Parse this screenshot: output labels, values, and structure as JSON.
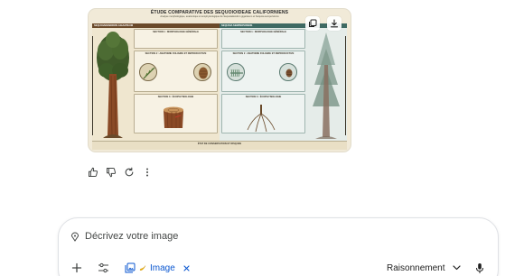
{
  "poster": {
    "title": "ÉTUDE COMPARATIVE DES SEQUOIOIDEAE CALIFORNIENS",
    "subtitle": "Analyse morphologique, anatomique et écophysiologique de Sequoiadendron giganteum et Sequoia sempervirens",
    "left": {
      "header": "SEQUOIADENDRON GIGANTEUM",
      "section1": "SECTION 1 : MORPHOLOGIE GÉNÉRALE",
      "section2": "SECTION 2 : ANATOMIE FOLIAIRE ET REPRODUCTIVE",
      "section3": "SECTION 3 : ÉCOPHYSIOLOGIE"
    },
    "right": {
      "header": "SEQUOIA SEMPERVIRENS",
      "section1": "SECTION 1 : MORPHOLOGIE GÉNÉRALE",
      "section2": "SECTION 2 : ANATOMIE FOLIAIRE ET REPRODUCTIVE",
      "section3": "SECTION 3 : ÉCOPHYSIOLOGIE"
    },
    "footer": "ÉTAT DE CONSERVATION ET RISQUES"
  },
  "poster_buttons": {
    "copy_icon": "copy-icon",
    "download_icon": "download-icon"
  },
  "actions": [
    {
      "icon": "thumb-up-icon"
    },
    {
      "icon": "thumb-down-icon"
    },
    {
      "icon": "regenerate-icon"
    },
    {
      "icon": "more-vert-icon"
    }
  ],
  "prompt": {
    "placeholder": "Décrivez votre image",
    "image_chip_label": "Image",
    "model_label": "Raisonnement"
  },
  "colors": {
    "accent": "#0b57d0",
    "text": "#1f1f1f",
    "muted": "#444746",
    "border": "#dfe1e5"
  }
}
